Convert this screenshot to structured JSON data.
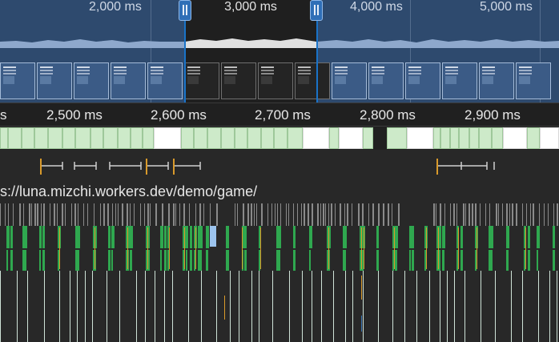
{
  "overview": {
    "labels": [
      "2,000 ms",
      "3,000 ms",
      "4,000 ms",
      "5,000 ms"
    ],
    "selection_label": "3,000 ms"
  },
  "ruler": {
    "labels": [
      "s",
      "2,500 ms",
      "2,600 ms",
      "2,700 ms",
      "2,800 ms",
      "2,900 ms"
    ]
  },
  "main": {
    "url": "s://luna.mizchi.workers.dev/demo/game/"
  },
  "colors": {
    "overview_bg": "#2e4a6e",
    "selection_bg": "#1f1f1f",
    "handle": "#2f6fb7",
    "frame_green": "#cdeac9",
    "frame_white": "#ffffff",
    "script_green": "#2fa84f",
    "task_gray": "#8a8a8a",
    "orange": "#d99a2b",
    "light_blue": "#9cc4ee"
  }
}
